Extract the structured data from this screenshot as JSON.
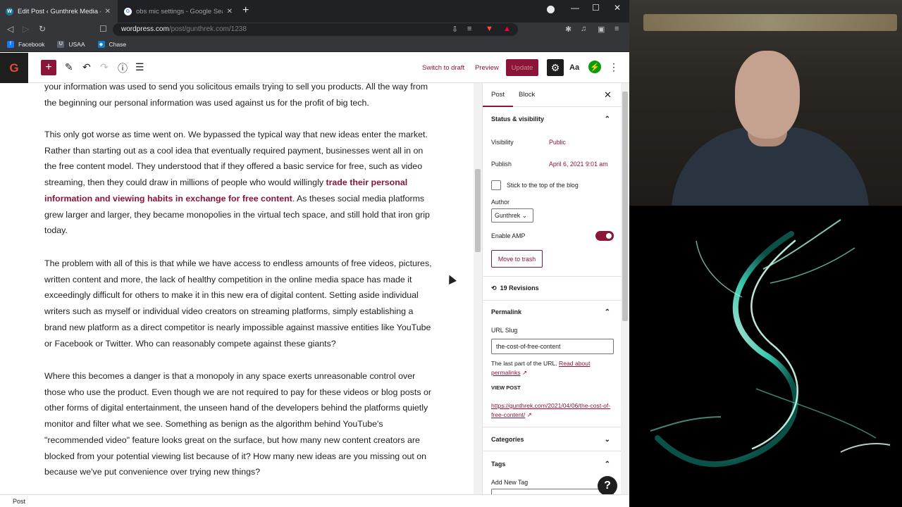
{
  "browser": {
    "tabs": [
      {
        "title": "Edit Post ‹ Gunthrek Media — W",
        "active": true
      },
      {
        "title": "obs mic settings - Google Search",
        "active": false
      }
    ],
    "url_domain": "wordpress.com",
    "url_path": "/post/gunthrek.com/1238",
    "bookmarks": [
      "Facebook",
      "USAA",
      "Chase"
    ]
  },
  "toolbar": {
    "logo": "G",
    "switch_to_draft": "Switch to draft",
    "preview": "Preview",
    "update": "Update",
    "aa": "Aa"
  },
  "content": {
    "p1_lines": "your information was used to send you solicitous emails trying to sell you products.  All the way from the beginning our personal information was used against us for the profit of big tech.",
    "p2_before": "This only got worse as time went on.  We bypassed the typical way that new ideas enter the market.  Rather than starting out as a cool idea that eventually required payment, businesses went all in on the free content model.  They understood that if they offered a basic service for free, such as video streaming, then they could draw in millions of people who would willingly ",
    "p2_link": "trade their personal information and viewing habits in exchange for free content",
    "p2_after": ".  As theses social media platforms grew larger and larger, they became monopolies in the virtual tech space, and still hold that iron grip today.",
    "p3": "The problem with all of this is that while we have access to endless amounts of free videos, pictures, written content and more, the lack of healthy competition in the online media space has made it exceedingly difficult for others to make it in this new era of digital content.  Setting aside individual writers such as myself or individual video creators on streaming platforms, simply establishing a brand new platform as a direct competitor is nearly impossible against massive entities like YouTube or Facebook or Twitter.  Who can reasonably compete against these giants?",
    "p4": "Where this becomes a danger is that a monopoly in any space exerts unreasonable control over those who use the product.  Even though we are not required to pay for these videos or blog posts or other forms of digital entertainment, the unseen hand of the developers behind the platforms quietly monitor and filter what we see.  Something as benign as the algorithm behind YouTube's \"recommended video\" feature looks great on the surface, but how many new content creators are blocked from your potential viewing list because of it?  How many new ideas are you missing out on because we've put convenience over trying new things?"
  },
  "sidebar": {
    "tab_post": "Post",
    "tab_block": "Block",
    "status_heading": "Status & visibility",
    "visibility_label": "Visibility",
    "visibility_value": "Public",
    "publish_label": "Publish",
    "publish_value": "April 6, 2021 9:01 am",
    "sticky_label": "Stick to the top of the blog",
    "author_label": "Author",
    "author_value": "Gunthrek",
    "amp_label": "Enable AMP",
    "trash_label": "Move to trash",
    "revisions": "19 Revisions",
    "permalink_heading": "Permalink",
    "slug_label": "URL Slug",
    "slug_value": "the-cost-of-free-content",
    "slug_help": "The last part of the URL.",
    "slug_help_link": "Read about permalinks",
    "view_post_label": "VIEW POST",
    "view_post_url": "https://gunthrek.com/2021/04/06/the-cost-of-free-content/",
    "categories_heading": "Categories",
    "tags_heading": "Tags",
    "add_tag_label": "Add New Tag"
  },
  "statusbar": {
    "label": "Post"
  },
  "help": {
    "label": "?"
  },
  "colors": {
    "accent": "#8b1538",
    "dark": "#1e1e1e",
    "jetpack": "#069e08"
  }
}
